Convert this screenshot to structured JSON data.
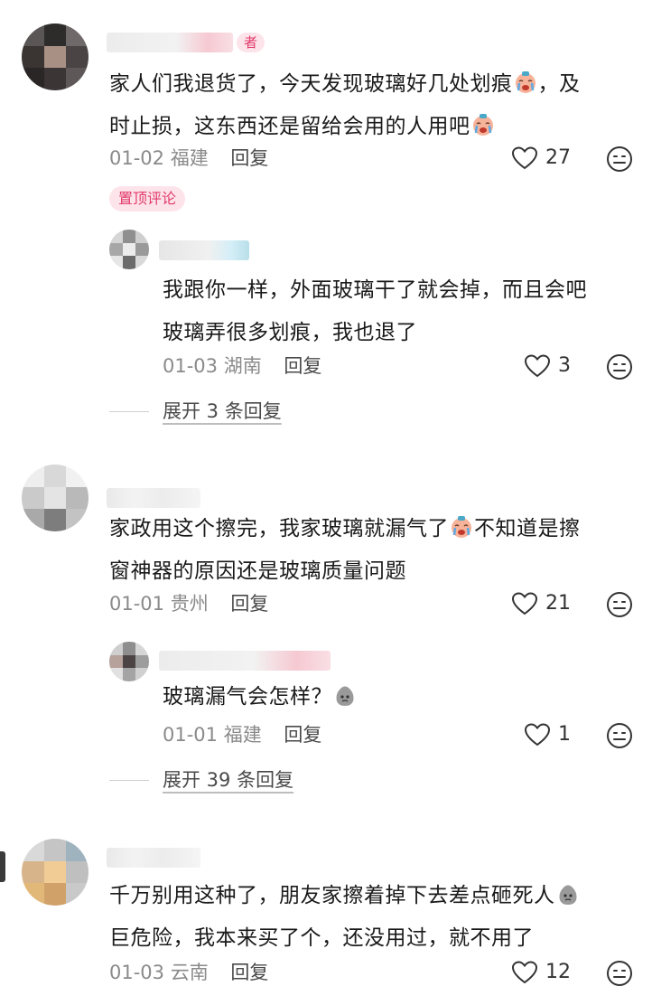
{
  "comments": [
    {
      "author_tag": "者",
      "text_line1": "家人们我退货了，今天发现玻璃好几处划痕",
      "text_line1_tail": "，及",
      "text_line2": "时止损，这东西还是留给会用的人用吧",
      "date": "01-02",
      "location": "福建",
      "reply_label": "回复",
      "likes": "27",
      "pinned_label": "置顶评论",
      "reply": {
        "text_line1": "我跟你一样，外面玻璃干了就会掉，而且会吧",
        "text_line2": "玻璃弄很多划痕，我也退了",
        "date": "01-03",
        "location": "湖南",
        "reply_label": "回复",
        "likes": "3"
      },
      "expand_label": "展开 3 条回复"
    },
    {
      "text_line1": "家政用这个擦完，我家玻璃就漏气了",
      "text_line1_tail": "不知道是擦",
      "text_line2": "窗神器的原因还是玻璃质量问题",
      "date": "01-01",
      "location": "贵州",
      "reply_label": "回复",
      "likes": "21",
      "reply": {
        "text_line1": "玻璃漏气会怎样？",
        "date": "01-01",
        "location": "福建",
        "reply_label": "回复",
        "likes": "1"
      },
      "expand_label": "展开 39 条回复"
    },
    {
      "text_line1": "千万别用这种了，朋友家擦着掉下去差点砸死人",
      "text_line2": "巨危险，我本来买了个，还没用过，就不用了",
      "date": "01-03",
      "location": "云南",
      "reply_label": "回复",
      "likes": "12"
    }
  ],
  "colors": {
    "accent_pink": "#e23a6a",
    "tag_bg": "#fde4ea",
    "meta_gray": "#8a8a8a"
  }
}
